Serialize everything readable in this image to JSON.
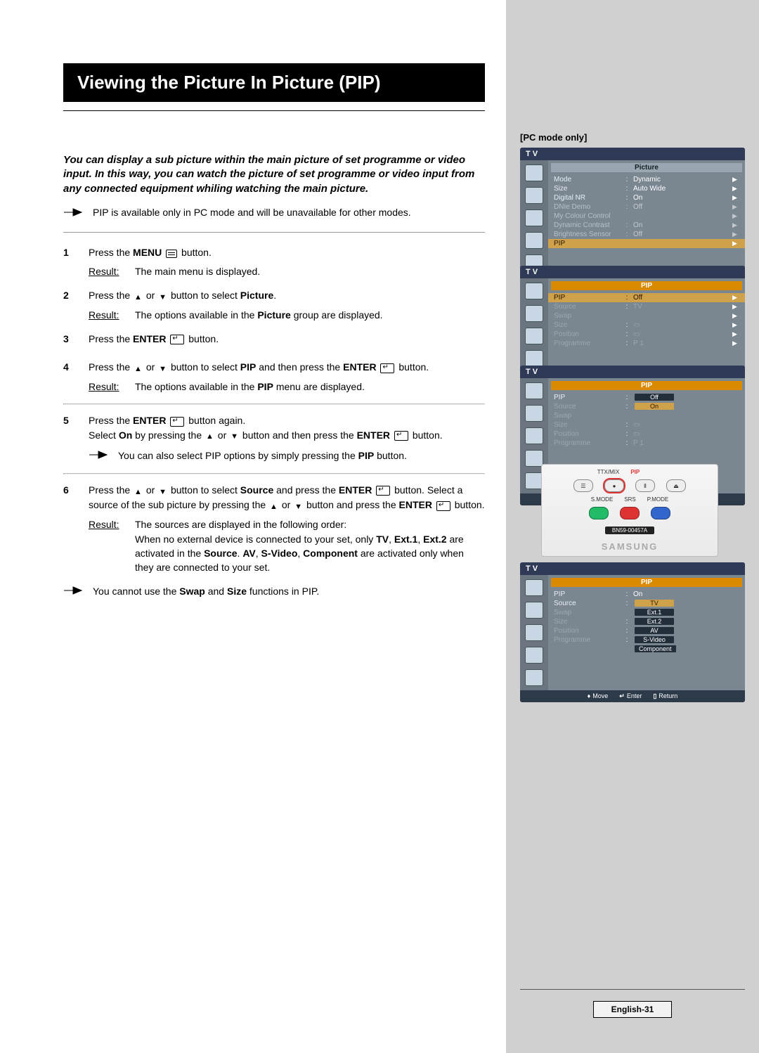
{
  "title": "Viewing the Picture In Picture (PIP)",
  "intro": "You can display a sub picture within the main picture of set programme or video input. In this way, you can watch the picture of set programme or  video input from any connected equipment whiling watching the main picture.",
  "top_note": "PIP is available only in PC mode and will be unavailable for other modes.",
  "steps": {
    "s1_a": "Press the ",
    "s1_menu": "MENU",
    "s1_b": " button.",
    "s1_res": "The main menu is displayed.",
    "s2_a": "Press the ",
    "s2_b": " or ",
    "s2_c": " button to select ",
    "s2_pic": "Picture",
    "s2_d": ".",
    "s2_res_a": "The options available in the ",
    "s2_res_b": " group are displayed.",
    "s3_a": "Press the ",
    "s3_enter": "ENTER",
    "s3_b": " button.",
    "s4_a": "Press the ",
    "s4_b": " or ",
    "s4_c": " button to select ",
    "s4_pip": "PIP",
    "s4_d": " and then press the ",
    "s4_e": " button.",
    "s4_res_a": "The options available in the ",
    "s4_res_b": " menu are displayed.",
    "s5_a": "Press the ",
    "s5_b": " button again.",
    "s5_c": "Select ",
    "s5_on": "On",
    "s5_d": " by pressing the ",
    "s5_e": " or ",
    "s5_f": " button and then press the ",
    "s5_g": " button.",
    "s5_note": "You can also select PIP options by simply pressing the ",
    "s5_note_pip": "PIP",
    "s5_note_end": " button.",
    "s6_a": "Press the ",
    "s6_b": " or ",
    "s6_c": " button to select ",
    "s6_src": "Source",
    "s6_d": " and press the ",
    "s6_e": " button. Select a source of the sub picture by pressing the ",
    "s6_f": " or ",
    "s6_g": " button and press the ",
    "s6_h": " button.",
    "s6_res_a": "The sources are displayed in the following order:",
    "s6_res_b": "When no external device is connected to your set, only ",
    "s6_res_c": " are activated in the ",
    "s6_res_d": ". ",
    "s6_res_e": " are activated only when they are connected to your set.",
    "s6_list1": "TV",
    "s6_list2": "Ext.1",
    "s6_list3": "Ext.2",
    "s6_src_word": "Source",
    "s6_list4": "AV",
    "s6_list5": "S-Video",
    "s6_list6": "Component",
    "s6_note_a": "You cannot use the ",
    "s6_swap": "Swap",
    "s6_and": " and ",
    "s6_size": "Size",
    "s6_note_b": " functions in PIP."
  },
  "result_label": "Result:",
  "right": {
    "pc_only": "[PC mode only]",
    "tv": "T V",
    "picture": "Picture",
    "pip": "PIP",
    "mode": "Mode",
    "mode_v": "Dynamic",
    "size": "Size",
    "size_v": "Auto Wide",
    "dnr": "Digital NR",
    "dnr_v": "On",
    "dnie": "DNIe Demo",
    "dnie_v": "Off",
    "mcc": "My Colour Control",
    "dc": "Dynamic Contrast",
    "dc_v": "On",
    "bs": "Brightness Sensor",
    "bs_v": "Off",
    "pip_row": "PIP",
    "pip_v_off": "Off",
    "pip_v_on": "On",
    "source": "Source",
    "source_v": "TV",
    "swap": "Swap",
    "position": "Position",
    "prog": "Programme",
    "prog_v": "P   1",
    "move": "Move",
    "enter": "Enter",
    "return": "Return",
    "remote": {
      "ttx": "TTX/MIX",
      "pip": "PIP",
      "smode": "S.MODE",
      "srs": "SRS",
      "pmode": "P.MODE",
      "model": "BN59-00457A",
      "brand": "SAMSUNG"
    },
    "src_list": [
      "TV",
      "Ext.1",
      "Ext.2",
      "AV",
      "S-Video",
      "Component"
    ]
  },
  "page_number": "English-31"
}
